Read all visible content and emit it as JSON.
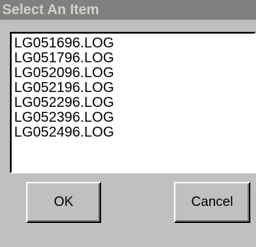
{
  "window": {
    "title": "Select An Item"
  },
  "list": {
    "items": [
      "LG051696.LOG",
      "LG051796.LOG",
      "LG052096.LOG",
      "LG052196.LOG",
      "LG052296.LOG",
      "LG052396.LOG",
      "LG052496.LOG"
    ]
  },
  "buttons": {
    "ok_label": "OK",
    "cancel_label": "Cancel"
  },
  "colors": {
    "titlebar_background": "#808080",
    "titlebar_text": "#d4d0c8",
    "dialog_background": "#c0c0c0",
    "list_background": "#ffffff"
  }
}
